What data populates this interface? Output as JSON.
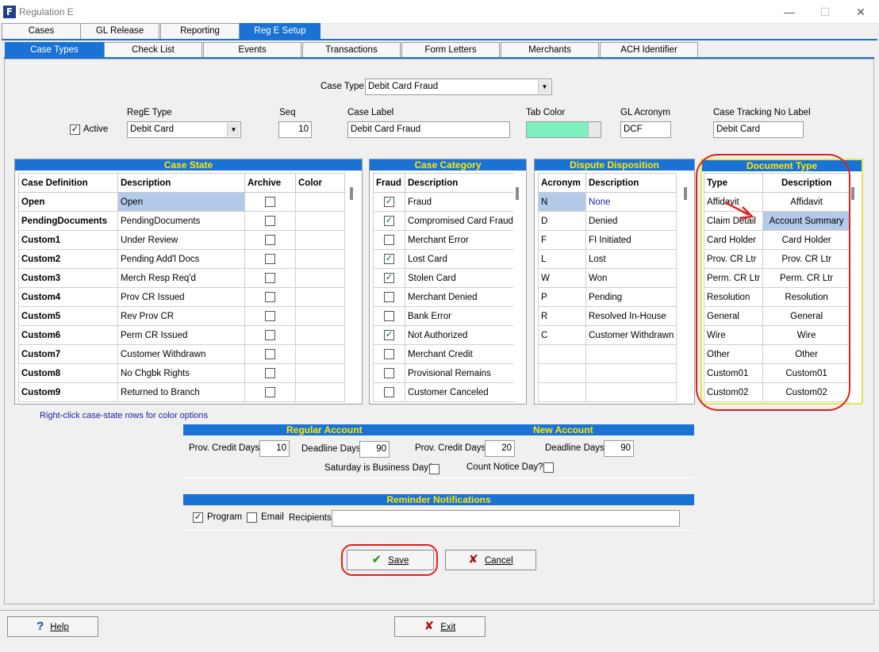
{
  "window": {
    "title": "Regulation E",
    "app_icon": "app-logo-icon",
    "minimize_glyph": "—",
    "maximize_glyph": "☐",
    "close_glyph": "✕"
  },
  "top_tabs": [
    {
      "label": "Cases"
    },
    {
      "label": "GL Release"
    },
    {
      "label": "Reporting"
    },
    {
      "label": "Reg E Setup",
      "active": true
    }
  ],
  "sub_tabs": [
    {
      "label": "Case Types",
      "active": true
    },
    {
      "label": "Check List"
    },
    {
      "label": "Events"
    },
    {
      "label": "Transactions"
    },
    {
      "label": "Form Letters"
    },
    {
      "label": "Merchants"
    },
    {
      "label": "ACH Identifier"
    }
  ],
  "case_type": {
    "label": "Case Type",
    "value": "Debit Card Fraud"
  },
  "active": {
    "label": "Active",
    "checked": true
  },
  "rege_type": {
    "label": "RegE Type",
    "value": "Debit Card"
  },
  "seq": {
    "label": "Seq",
    "value": "10"
  },
  "case_label": {
    "label": "Case Label",
    "value": "Debit Card Fraud"
  },
  "tab_color": {
    "label": "Tab Color",
    "color": "#7ff0c0"
  },
  "gl_acronym": {
    "label": "GL Acronym",
    "value": "DCF"
  },
  "tracking_label": {
    "label": "Case Tracking No Label",
    "value": "Debit Card"
  },
  "case_state": {
    "title": "Case State",
    "columns": [
      "Case Definition",
      "Description",
      "Archive",
      "Color"
    ],
    "rows": [
      {
        "definition": "Open",
        "description": "Open",
        "archive": false,
        "selected": true
      },
      {
        "definition": "PendingDocuments",
        "description": "PendingDocuments",
        "archive": false
      },
      {
        "definition": "Custom1",
        "description": "Under Review",
        "archive": false
      },
      {
        "definition": "Custom2",
        "description": "Pending Add'l Docs",
        "archive": false
      },
      {
        "definition": "Custom3",
        "description": "Merch Resp Req'd",
        "archive": false
      },
      {
        "definition": "Custom4",
        "description": "Prov CR Issued",
        "archive": false
      },
      {
        "definition": "Custom5",
        "description": "Rev Prov CR",
        "archive": false
      },
      {
        "definition": "Custom6",
        "description": "Perm CR Issued",
        "archive": false
      },
      {
        "definition": "Custom7",
        "description": "Customer Withdrawn",
        "archive": false
      },
      {
        "definition": "Custom8",
        "description": "No Chgbk Rights",
        "archive": false
      },
      {
        "definition": "Custom9",
        "description": "Returned to Branch",
        "archive": false
      }
    ],
    "hint": "Right-click case-state rows for color options"
  },
  "case_category": {
    "title": "Case Category",
    "columns": [
      "Fraud",
      "Description"
    ],
    "rows": [
      {
        "fraud": true,
        "description": "Fraud"
      },
      {
        "fraud": true,
        "description": "Compromised Card Fraud"
      },
      {
        "fraud": false,
        "description": "Merchant Error"
      },
      {
        "fraud": true,
        "description": "Lost Card"
      },
      {
        "fraud": true,
        "description": "Stolen Card"
      },
      {
        "fraud": false,
        "description": "Merchant Denied"
      },
      {
        "fraud": false,
        "description": "Bank Error"
      },
      {
        "fraud": true,
        "description": "Not Authorized"
      },
      {
        "fraud": false,
        "description": "Merchant Credit"
      },
      {
        "fraud": false,
        "description": "Provisional Remains"
      },
      {
        "fraud": false,
        "description": "Customer Canceled"
      }
    ]
  },
  "dispute_disposition": {
    "title": "Dispute Disposition",
    "columns": [
      "Acronym",
      "Description"
    ],
    "rows": [
      {
        "acronym": "N",
        "description": "None",
        "selected": true
      },
      {
        "acronym": "D",
        "description": "Denied"
      },
      {
        "acronym": "F",
        "description": "FI Initiated"
      },
      {
        "acronym": "L",
        "description": "Lost"
      },
      {
        "acronym": "W",
        "description": "Won"
      },
      {
        "acronym": "P",
        "description": "Pending"
      },
      {
        "acronym": "R",
        "description": "Resolved In-House"
      },
      {
        "acronym": "C",
        "description": "Customer Withdrawn"
      }
    ]
  },
  "document_type": {
    "title": "Document Type",
    "columns": [
      "Type",
      "Description"
    ],
    "rows": [
      {
        "type": "Affidavit",
        "description": "Affidavit"
      },
      {
        "type": "Claim Detail",
        "description": "Account Summary",
        "selected": true
      },
      {
        "type": "Card Holder",
        "description": "Card Holder"
      },
      {
        "type": "Prov. CR Ltr",
        "description": "Prov. CR Ltr"
      },
      {
        "type": "Perm. CR Ltr",
        "description": "Perm. CR Ltr"
      },
      {
        "type": "Resolution",
        "description": "Resolution"
      },
      {
        "type": "General",
        "description": "General"
      },
      {
        "type": "Wire",
        "description": "Wire"
      },
      {
        "type": "Other",
        "description": "Other"
      },
      {
        "type": "Custom01",
        "description": "Custom01"
      },
      {
        "type": "Custom02",
        "description": "Custom02"
      }
    ]
  },
  "accounts": {
    "regular_title": "Regular Account",
    "new_title": "New Account",
    "regular_prov_label": "Prov. Credit Days",
    "regular_prov_value": "10",
    "regular_deadline_label": "Deadline Days",
    "regular_deadline_value": "90",
    "new_prov_label": "Prov. Credit Days",
    "new_prov_value": "20",
    "new_deadline_label": "Deadline Days",
    "new_deadline_value": "90",
    "saturday_label": "Saturday is Business Day?",
    "saturday_checked": false,
    "count_notice_label": "Count Notice Day?",
    "count_notice_checked": false
  },
  "reminders": {
    "title": "Reminder Notifications",
    "program_label": "Program",
    "program_checked": true,
    "email_label": "Email",
    "email_checked": false,
    "recipients_label": "Recipients",
    "recipients_value": ""
  },
  "buttons": {
    "save": "Save",
    "cancel": "Cancel",
    "help": "Help",
    "exit": "Exit"
  },
  "colors": {
    "accent": "#1a73d4",
    "panel_title": "#ffe800",
    "selection": "#b3cbe9",
    "annotation": "#e02020"
  }
}
